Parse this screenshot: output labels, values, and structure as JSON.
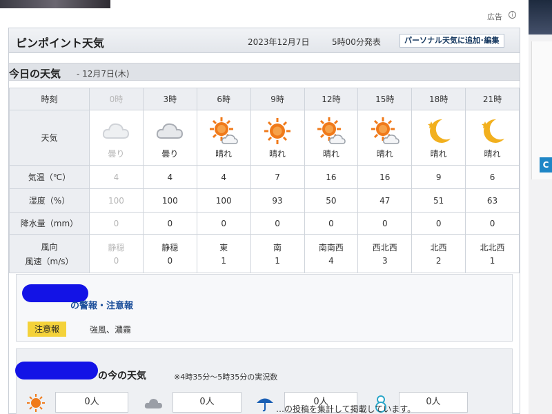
{
  "ad": {
    "label": "広告",
    "icon": "info-icon"
  },
  "header": {
    "title": "ピンポイント天気",
    "date": "2023年12月7日",
    "time": "5時00分発表",
    "personal_button": "パーソナル天気に追加･編集"
  },
  "today": {
    "title": "今日の天気",
    "date": "- 12月7日(木)"
  },
  "forecast": {
    "row_labels": {
      "time": "時刻",
      "weather": "天気",
      "temp": "気温（℃）",
      "humidity": "湿度（%）",
      "precip": "降水量（mm）",
      "wind_dir": "風向",
      "wind_speed": "風速（m/s）"
    },
    "columns": [
      {
        "time": "0時",
        "icon": "cloud-icon",
        "cond": "曇り",
        "temp": "4",
        "humidity": "100",
        "precip": "0",
        "wind_dir": "静穏",
        "wind_speed": "0",
        "past": true
      },
      {
        "time": "3時",
        "icon": "cloud-icon",
        "cond": "曇り",
        "temp": "4",
        "humidity": "100",
        "precip": "0",
        "wind_dir": "静穏",
        "wind_speed": "0",
        "past": false
      },
      {
        "time": "6時",
        "icon": "sun-cloud-icon",
        "cond": "晴れ",
        "temp": "4",
        "humidity": "100",
        "precip": "0",
        "wind_dir": "東",
        "wind_speed": "1",
        "past": false
      },
      {
        "time": "9時",
        "icon": "sun-icon",
        "cond": "晴れ",
        "temp": "7",
        "humidity": "93",
        "precip": "0",
        "wind_dir": "南",
        "wind_speed": "1",
        "past": false
      },
      {
        "time": "12時",
        "icon": "sun-cloud-icon",
        "cond": "晴れ",
        "temp": "16",
        "humidity": "50",
        "precip": "0",
        "wind_dir": "南南西",
        "wind_speed": "4",
        "past": false
      },
      {
        "time": "15時",
        "icon": "sun-cloud-icon",
        "cond": "晴れ",
        "temp": "16",
        "humidity": "47",
        "precip": "0",
        "wind_dir": "西北西",
        "wind_speed": "3",
        "past": false
      },
      {
        "time": "18時",
        "icon": "moon-icon",
        "cond": "晴れ",
        "temp": "9",
        "humidity": "51",
        "precip": "0",
        "wind_dir": "北西",
        "wind_speed": "2",
        "past": false
      },
      {
        "time": "21時",
        "icon": "moon-icon",
        "cond": "晴れ",
        "temp": "6",
        "humidity": "63",
        "precip": "0",
        "wind_dir": "北北西",
        "wind_speed": "1",
        "past": false
      }
    ]
  },
  "warnings": {
    "title": "の警報・注意報",
    "badge": "注意報",
    "text": "強風、濃霧"
  },
  "now": {
    "title": "の今の天気",
    "note": "※4時35分～5時35分の実況数",
    "counts": [
      {
        "icon": "sun-icon",
        "value": "0人"
      },
      {
        "icon": "cloud-icon",
        "value": "0人"
      },
      {
        "icon": "umbrella-icon",
        "value": "0人"
      },
      {
        "icon": "snowman-icon",
        "value": "0人"
      }
    ]
  },
  "footer_text": "…の投稿を集計して掲載しています。",
  "colors": {
    "sun": "#f07a1a",
    "moon": "#f2b01e",
    "cloud": "#b9bcc2",
    "warning_badge": "#f4d23a",
    "link": "#1a4d99"
  }
}
